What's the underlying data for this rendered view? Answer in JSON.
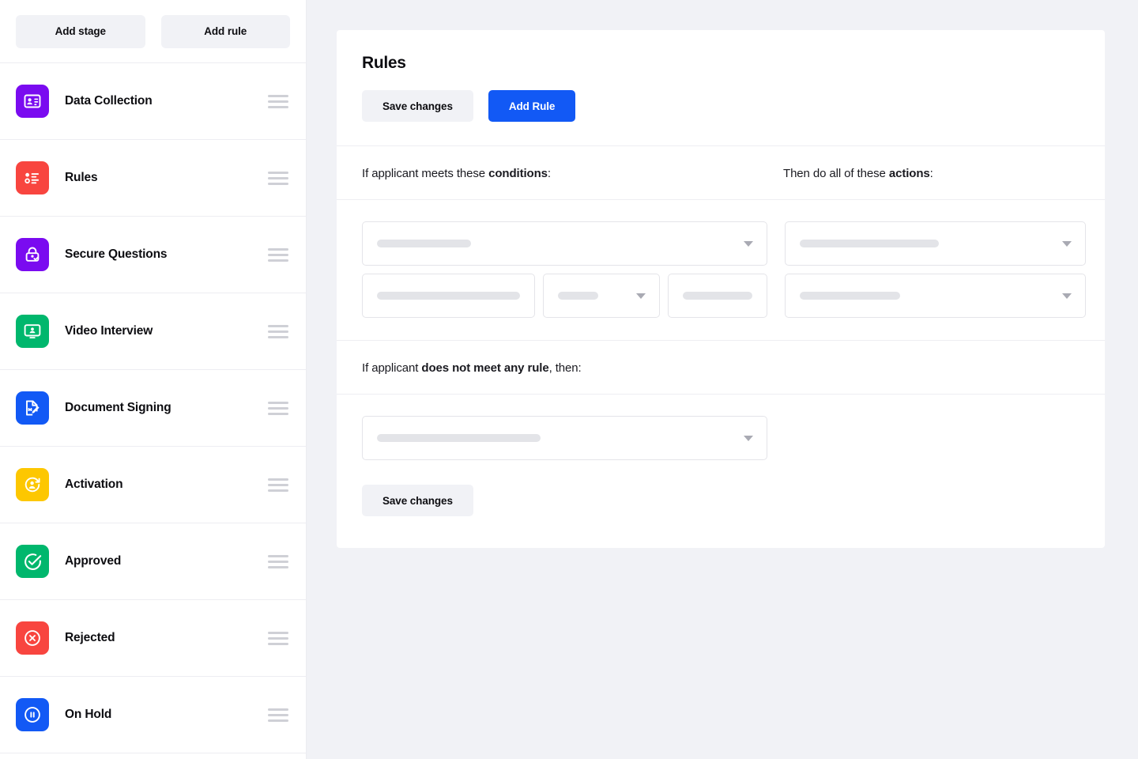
{
  "sidebar": {
    "add_stage_label": "Add stage",
    "add_rule_label": "Add rule",
    "stages": [
      {
        "label": "Data Collection",
        "icon": "id-card-icon",
        "color": "#7a0bf0"
      },
      {
        "label": "Rules",
        "icon": "bullet-list-icon",
        "color": "#f8453f"
      },
      {
        "label": "Secure Questions",
        "icon": "lock-check-icon",
        "color": "#7a0bf0"
      },
      {
        "label": "Video Interview",
        "icon": "monitor-person-icon",
        "color": "#00b76d"
      },
      {
        "label": "Document Signing",
        "icon": "document-pen-icon",
        "color": "#1259f5"
      },
      {
        "label": "Activation",
        "icon": "person-refresh-icon",
        "color": "#fdc700"
      },
      {
        "label": "Approved",
        "icon": "check-circle-icon",
        "color": "#00b76d"
      },
      {
        "label": "Rejected",
        "icon": "x-circle-icon",
        "color": "#f8453f"
      },
      {
        "label": "On Hold",
        "icon": "pause-circle-icon",
        "color": "#1259f5"
      }
    ],
    "drag_handle_icon": "drag-handle-icon"
  },
  "main": {
    "card_title": "Rules",
    "save_changes_label": "Save changes",
    "add_rule_label": "Add Rule",
    "accent_color": "#1259f5",
    "conditions_prompt": {
      "lead": "If applicant meets these ",
      "emphasis": "conditions",
      "tail": ":"
    },
    "actions_prompt": {
      "lead": "Then do all of these ",
      "emphasis": "actions",
      "tail": ":"
    },
    "fallback_prompt": {
      "lead": "If applicant ",
      "emphasis": "does not meet any rule",
      "tail": ", then:"
    },
    "conditions": {
      "primary_select": {
        "value": "",
        "placeholder": "",
        "caret_icon": "chevron-down-icon",
        "skeleton_width": 119
      },
      "field_select": {
        "value": "",
        "placeholder": "",
        "skeleton_width": 181
      },
      "operator_select": {
        "value": "",
        "placeholder": "",
        "caret_icon": "chevron-down-icon",
        "skeleton_width": 51
      },
      "value_select": {
        "value": "",
        "placeholder": "",
        "skeleton_width": 88
      }
    },
    "actions": {
      "action_select_1": {
        "value": "",
        "placeholder": "",
        "caret_icon": "chevron-down-icon",
        "skeleton_width": 176
      },
      "action_select_2": {
        "value": "",
        "placeholder": "",
        "caret_icon": "chevron-down-icon",
        "skeleton_width": 127
      }
    },
    "fallback": {
      "action_select": {
        "value": "",
        "placeholder": "",
        "caret_icon": "chevron-down-icon",
        "skeleton_width": 207
      },
      "save_changes_label": "Save changes"
    }
  }
}
